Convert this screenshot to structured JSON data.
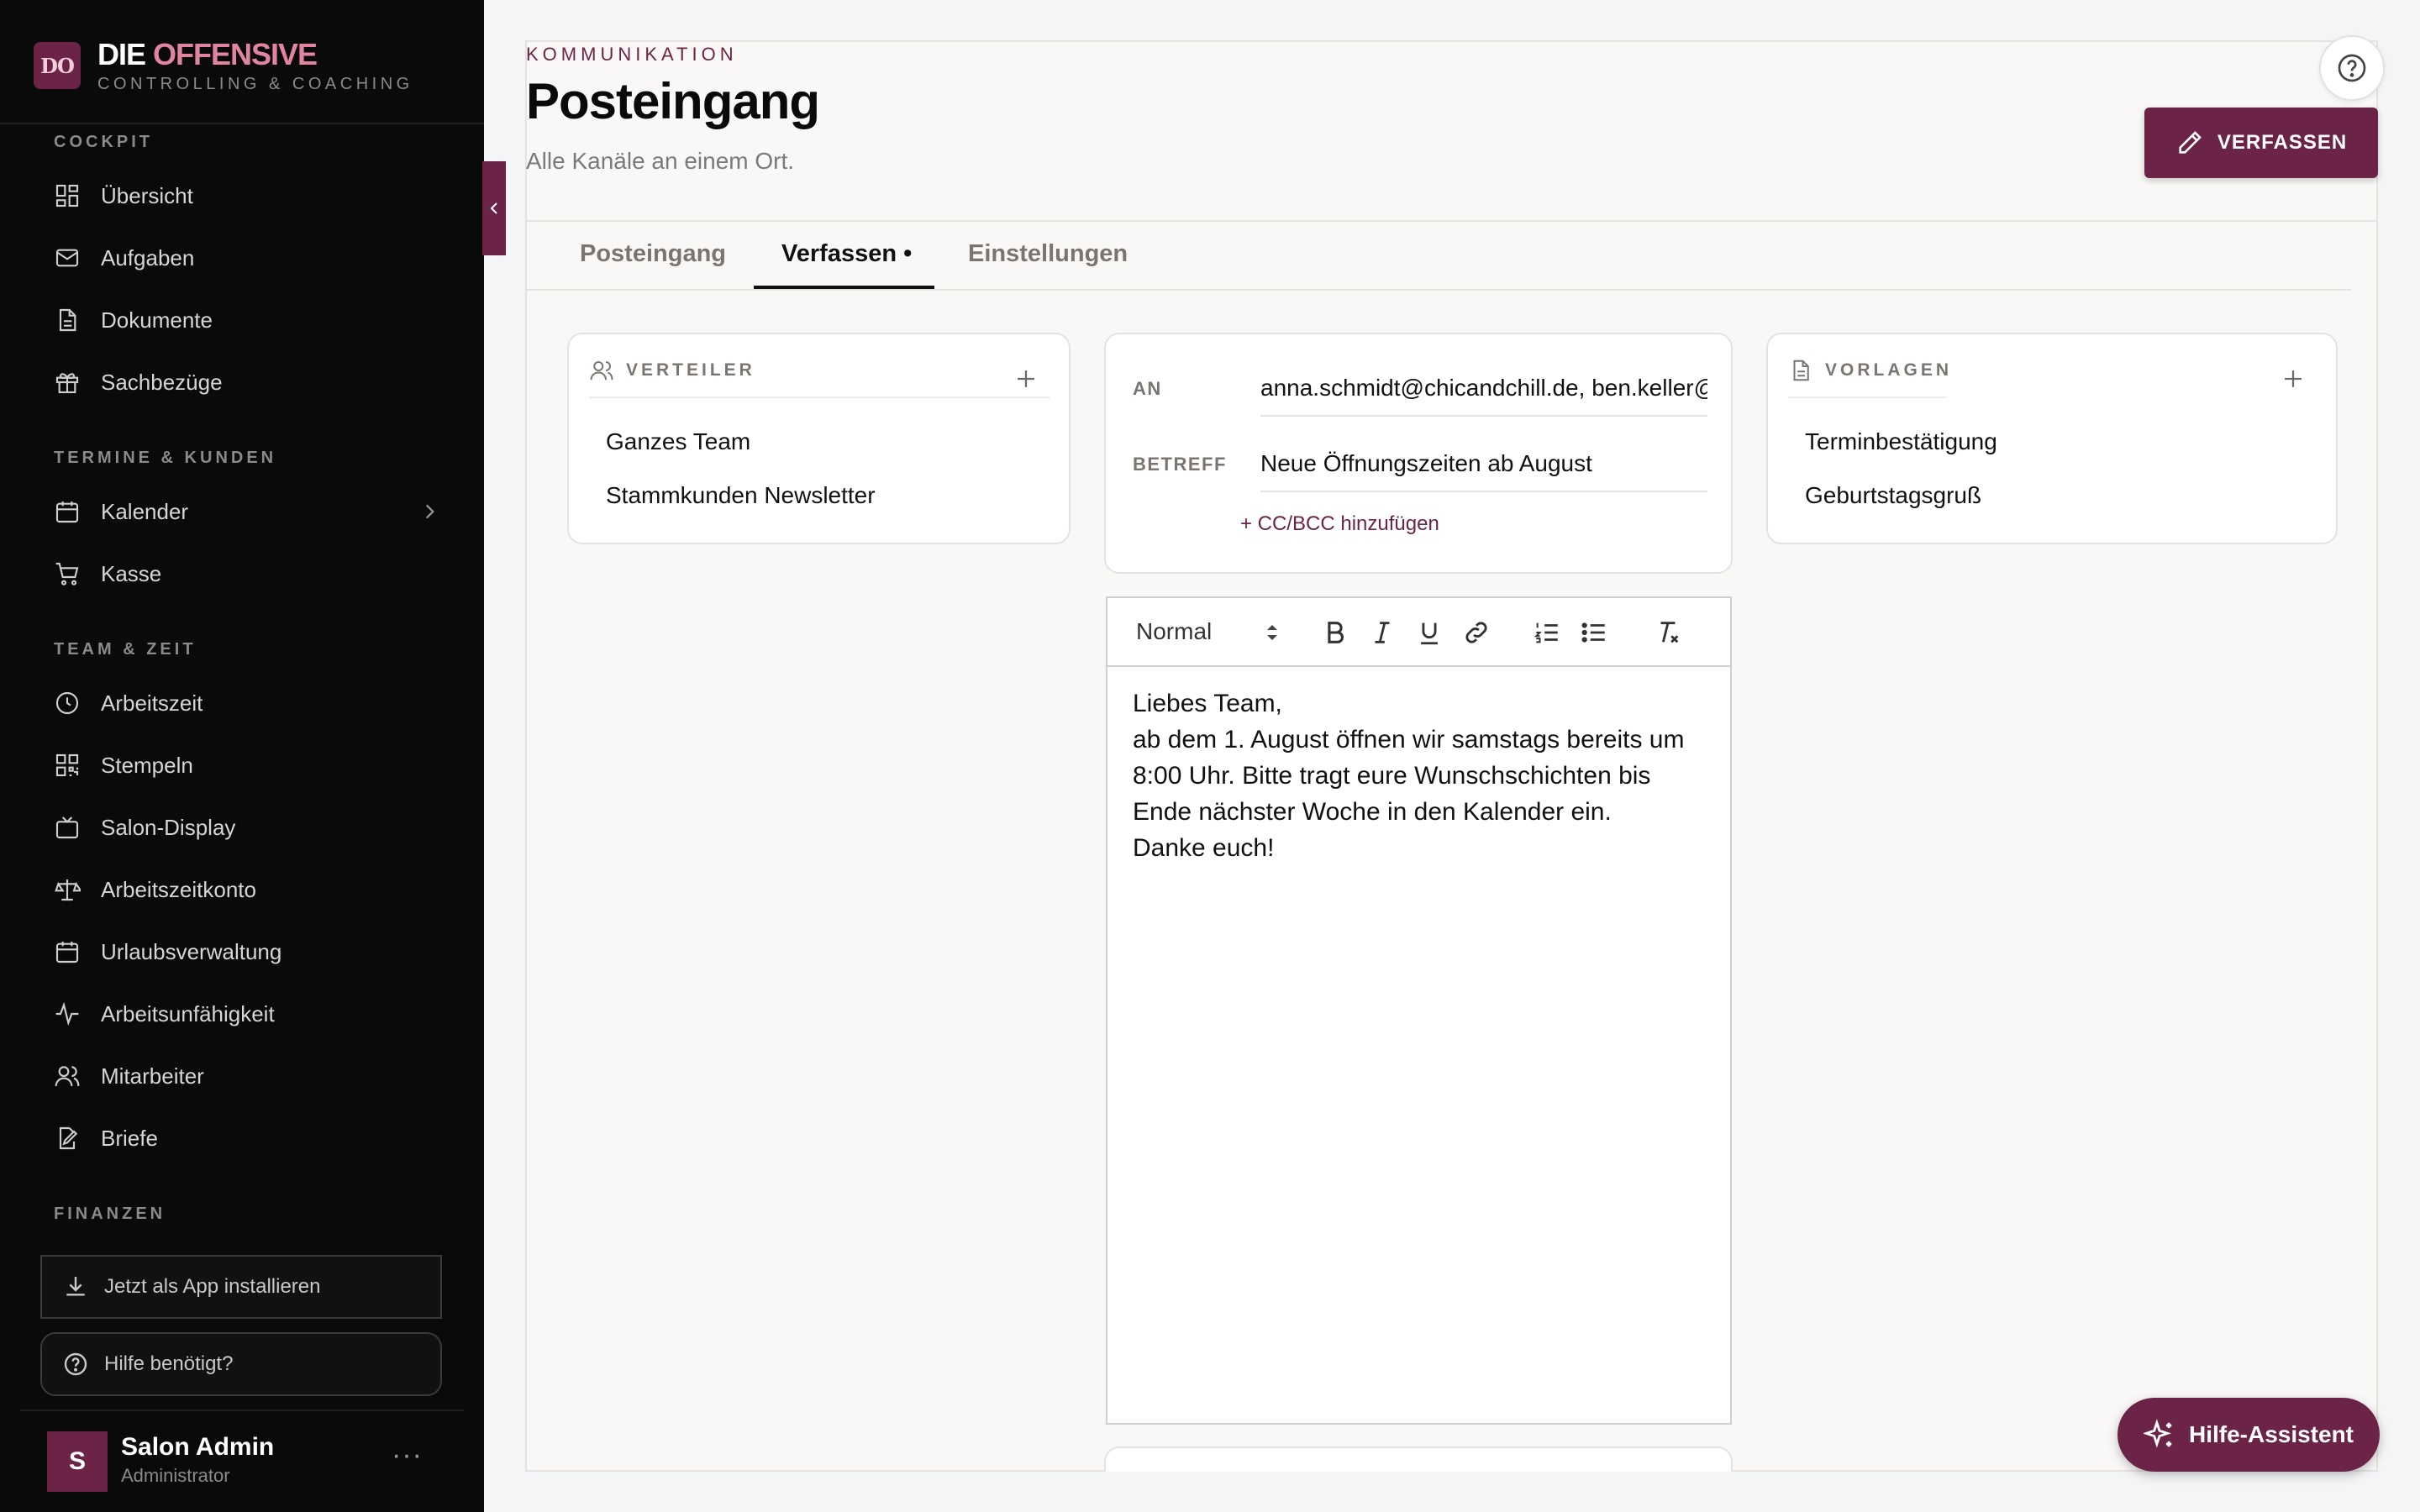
{
  "brand": {
    "logo": "DO",
    "name_part1": "DIE",
    "name_part2": "OFFENSIVE",
    "subtitle": "CONTROLLING & COACHING",
    "accent_color": "#e0849f"
  },
  "sidebar": {
    "sections": [
      {
        "label": "COCKPIT"
      },
      {
        "label": "TERMINE & KUNDEN"
      },
      {
        "label": "TEAM & ZEIT"
      },
      {
        "label": "FINANZEN"
      }
    ],
    "items": [
      {
        "label": "Übersicht",
        "icon": "grid-icon"
      },
      {
        "label": "Aufgaben",
        "icon": "mail-icon"
      },
      {
        "label": "Dokumente",
        "icon": "document-icon"
      },
      {
        "label": "Sachbezüge",
        "icon": "gift-icon"
      },
      {
        "label": "Kalender",
        "icon": "calendar-icon"
      },
      {
        "label": "Kasse",
        "icon": "cart-icon"
      },
      {
        "label": "Arbeitszeit",
        "icon": "clock-icon"
      },
      {
        "label": "Stempeln",
        "icon": "qr-code-icon"
      },
      {
        "label": "Salon-Display",
        "icon": "tv-icon"
      },
      {
        "label": "Arbeitszeitkonto",
        "icon": "scale-icon"
      },
      {
        "label": "Urlaubsverwaltung",
        "icon": "calendar-icon"
      },
      {
        "label": "Arbeitsunfähigkeit",
        "icon": "activity-icon"
      },
      {
        "label": "Mitarbeiter",
        "icon": "users-icon"
      },
      {
        "label": "Briefe",
        "icon": "pen-document-icon"
      }
    ],
    "install_label": "Jetzt als App installieren",
    "help_label": "Hilfe benötigt?",
    "user": {
      "initial": "S",
      "name": "Salon Admin",
      "role": "Administrator"
    }
  },
  "header": {
    "kicker": "KOMMUNIKATION",
    "title": "Posteingang",
    "subtitle": "Alle Kanäle an einem Ort.",
    "compose_label": "VERFASSEN"
  },
  "tabs": [
    {
      "label": "Posteingang",
      "active": false
    },
    {
      "label": "Verfassen •",
      "active": true
    },
    {
      "label": "Einstellungen",
      "active": false
    }
  ],
  "distribution": {
    "title": "VERTEILER",
    "items": [
      "Ganzes Team",
      "Stammkunden Newsletter"
    ]
  },
  "compose": {
    "to_label": "AN",
    "to_value": "anna.schmidt@chicandchill.de, ben.keller@",
    "subject_label": "BETREFF",
    "subject_value": "Neue Öffnungszeiten ab August",
    "cc_link": "+ CC/BCC hinzufügen"
  },
  "editor": {
    "format_select": "Normal",
    "body_lines": [
      "Liebes Team,",
      "ab dem 1. August öffnen wir samstags bereits um 8:00 Uhr. Bitte tragt eure Wunschschichten bis Ende nächster Woche in den Kalender ein.",
      "Danke euch!"
    ]
  },
  "templates": {
    "title": "VORLAGEN",
    "items": [
      "Terminbestätigung",
      "Geburtstagsgruß"
    ]
  },
  "assistant_label": "Hilfe-Assistent",
  "colors": {
    "primary": "#6b2447",
    "sidebar_bg": "#0a0a0a",
    "panel_bg": "#f9f8f6"
  }
}
